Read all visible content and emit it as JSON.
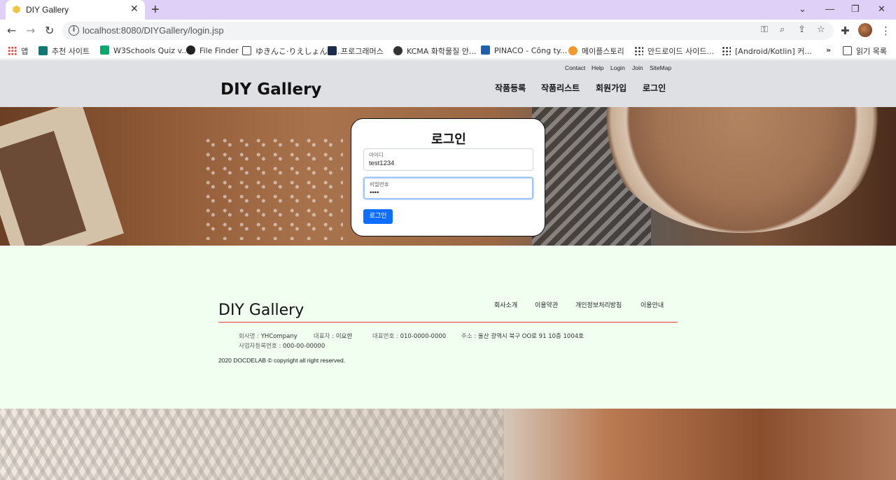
{
  "browser": {
    "tab_title": "DIY Gallery",
    "url": "localhost:8080/DIYGallery/login.jsp",
    "bookmarks": [
      {
        "label": "앱",
        "icon": "apps-grid-icon"
      },
      {
        "label": "추천 사이트",
        "icon": "bing-icon"
      },
      {
        "label": "W3Schools Quiz v...",
        "icon": "w3schools-icon"
      },
      {
        "label": "File Finder",
        "icon": "github-icon"
      },
      {
        "label": "ゆきんこ·りえしょんの...",
        "icon": "tv-icon"
      },
      {
        "label": "프로그래머스",
        "icon": "programmers-icon"
      },
      {
        "label": "KCMA 화학물질 안...",
        "icon": "globe-icon"
      },
      {
        "label": "PINACO - Công ty...",
        "icon": "pinaco-icon"
      },
      {
        "label": "메이플스토리",
        "icon": "maplestory-icon"
      },
      {
        "label": "안드로이드 사이드...",
        "icon": "dots-icon"
      },
      {
        "label": "[Android/Kotlin] 커...",
        "icon": "dots-icon"
      }
    ],
    "more_bookmarks": "»",
    "reading_list": "읽기 목록"
  },
  "header": {
    "util_links": [
      "Contact",
      "Help",
      "Login",
      "Join",
      "SiteMap"
    ],
    "brand": "DIY Gallery",
    "nav": [
      "작품등록",
      "작품리스트",
      "회원가입",
      "로그인"
    ]
  },
  "login": {
    "title": "로그인",
    "id_label": "아이디",
    "id_value": "test1234",
    "pw_label": "비밀번호",
    "pw_value": "••••",
    "button": "로그인"
  },
  "footer": {
    "brand": "DIY Gallery",
    "links": [
      "회사소개",
      "이용약관",
      "개인정보처리방침",
      "이용안내"
    ],
    "company_key": "회사명 :",
    "company_val": "YHCompany",
    "ceo_key": "대표자 :",
    "ceo_val": "이요한",
    "phone_key": "대표번호 :",
    "phone_val": "010-0000-0000",
    "addr_key": "주소 :",
    "addr_val": "울산 광역시 북구 OO로 91 10층 1004호",
    "biz_key": "사업자등록번호 :",
    "biz_val": "000-00-00000",
    "copyright": "2020 DOCDELAB © copyright all right reserved."
  },
  "colors": {
    "tabbar": "#dfd0f7",
    "header_bg": "#dee0e4",
    "footer_bg": "#f0fff0",
    "footer_rule": "#e53935",
    "login_button": "#0d6efd"
  }
}
